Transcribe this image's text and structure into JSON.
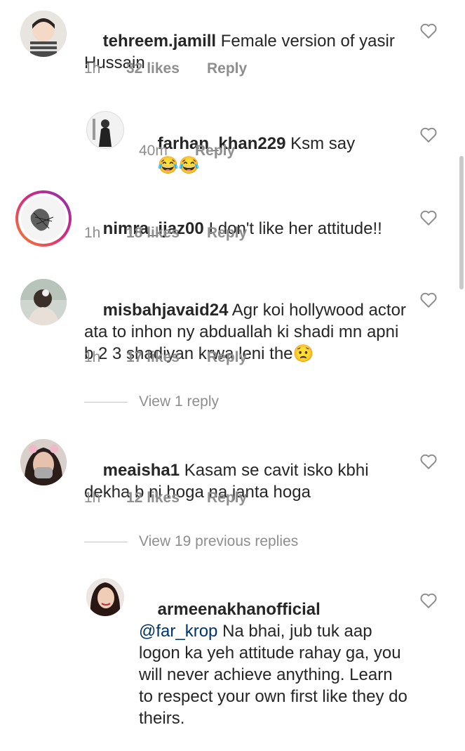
{
  "comments": [
    {
      "username": "tehreem.jamill",
      "text": "Female version of yasir Hussain",
      "time": "1h",
      "likes": "32 likes",
      "reply": "Reply"
    },
    {
      "username": "farhan_khan229",
      "text": "Ksm say",
      "emoji": "😂😂",
      "time": "40m",
      "reply": "Reply"
    },
    {
      "username": "nimra_ijaz00",
      "text": "I don't like her attitude!!",
      "time": "1h",
      "likes": "18 likes",
      "reply": "Reply"
    },
    {
      "username": "misbahjavaid24",
      "text": "Agr koi hollywood actor ata to inhon ny abduallah ki shadi mn apni b 2 3 shadiyan krwa leni the",
      "emoji": "😟",
      "time": "1h",
      "likes": "17 likes",
      "reply": "Reply",
      "view_replies": "View 1 reply"
    },
    {
      "username": "meaisha1",
      "text": "Kasam se cavit isko kbhi dekha b ni hoga na janta hoga",
      "time": "1h",
      "likes": "12 likes",
      "reply": "Reply",
      "view_replies": "View 19 previous replies"
    },
    {
      "username": "armeenakhanofficial",
      "mention": "@far_krop",
      "text": "Na bhai, jub tuk aap logon ka yeh attitude rahay ga, you will never achieve anything. Learn to respect your own first like they do theirs."
    }
  ],
  "colors": {
    "text": "#262626",
    "meta": "#8e8e8e",
    "mention": "#003569",
    "story_ring": [
      "#f58529",
      "#dd2a7b",
      "#8134af"
    ]
  }
}
